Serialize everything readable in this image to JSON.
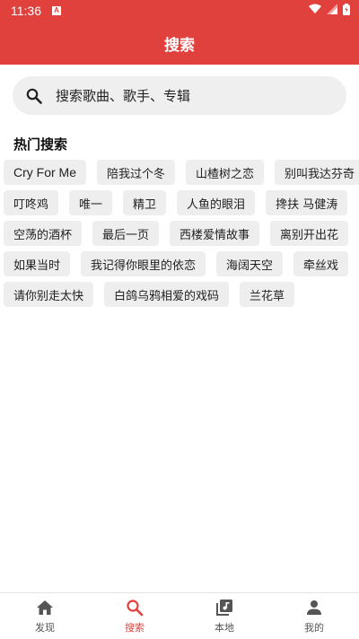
{
  "status_bar": {
    "time": "11:36",
    "indicator": "A",
    "icons": [
      "wifi-icon",
      "signal-icon",
      "battery-icon"
    ]
  },
  "header": {
    "title": "搜索"
  },
  "search": {
    "placeholder": "搜索歌曲、歌手、专辑"
  },
  "hot": {
    "title": "热门搜索",
    "rows": [
      [
        "Cry For Me",
        "陪我过个冬",
        "山楂树之恋",
        "别叫我达芬奇"
      ],
      [
        "叮咚鸡",
        "唯一",
        "精卫",
        "人鱼的眼泪",
        "搀扶  马健涛"
      ],
      [
        "空荡的酒杯",
        "最后一页",
        "西楼爱情故事",
        "离别开出花"
      ],
      [
        "如果当时",
        "我记得你眼里的依恋",
        "海阔天空",
        "牵丝戏"
      ],
      [
        "请你别走太快",
        "白鸽乌鸦相爱的戏码",
        "兰花草"
      ]
    ]
  },
  "bottom_nav": {
    "items": [
      {
        "label": "发现",
        "icon": "home-icon"
      },
      {
        "label": "搜索",
        "icon": "search-icon"
      },
      {
        "label": "本地",
        "icon": "music-library-icon"
      },
      {
        "label": "我的",
        "icon": "person-icon"
      }
    ],
    "active": "搜索"
  },
  "colors": {
    "primary": "#e0413c",
    "chip_bg": "#eeeeee",
    "search_bg": "#efefef"
  }
}
